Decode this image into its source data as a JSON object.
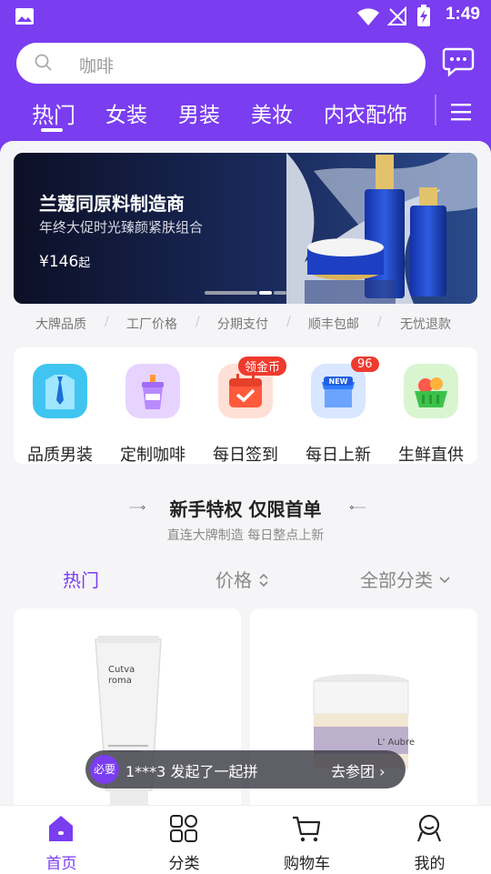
{
  "status_bar": {
    "time": "1:49"
  },
  "search": {
    "placeholder": "咖啡"
  },
  "tabs": [
    {
      "label": "热门"
    },
    {
      "label": "女装"
    },
    {
      "label": "男装"
    },
    {
      "label": "美妆"
    },
    {
      "label": "内衣配饰"
    }
  ],
  "banner": {
    "title": "兰蔻同原料制造商",
    "subtitle": "年终大促时光臻颜紧肤组合",
    "price": "¥146",
    "price_suffix": "起"
  },
  "guarantees": [
    "大牌品质",
    "工厂价格",
    "分期支付",
    "顺丰包邮",
    "无忧退款"
  ],
  "categories": [
    {
      "label": "品质男装",
      "icon": "shirt-tie-icon",
      "badge": ""
    },
    {
      "label": "定制咖啡",
      "icon": "coffee-cup-icon",
      "badge": ""
    },
    {
      "label": "每日签到",
      "icon": "calendar-check-icon",
      "badge": "领金币"
    },
    {
      "label": "每日上新",
      "icon": "new-store-icon",
      "badge": "96"
    },
    {
      "label": "生鲜直供",
      "icon": "fruit-basket-icon",
      "badge": ""
    }
  ],
  "section": {
    "title": "新手特权 仅限首单",
    "subtitle": "直连大牌制造 每日整点上新"
  },
  "sort": {
    "hot": "热门",
    "price": "价格",
    "all": "全部分类"
  },
  "toast": {
    "avatar": "必要",
    "message": "1***3 发起了一起拼",
    "action": "去参团"
  },
  "bottom_nav": [
    {
      "label": "首页",
      "icon": "home-icon"
    },
    {
      "label": "分类",
      "icon": "grid-icon"
    },
    {
      "label": "购物车",
      "icon": "cart-icon"
    },
    {
      "label": "我的",
      "icon": "profile-icon"
    }
  ],
  "colors": {
    "brand": "#7a3df0",
    "badge": "#ef3a2e"
  }
}
